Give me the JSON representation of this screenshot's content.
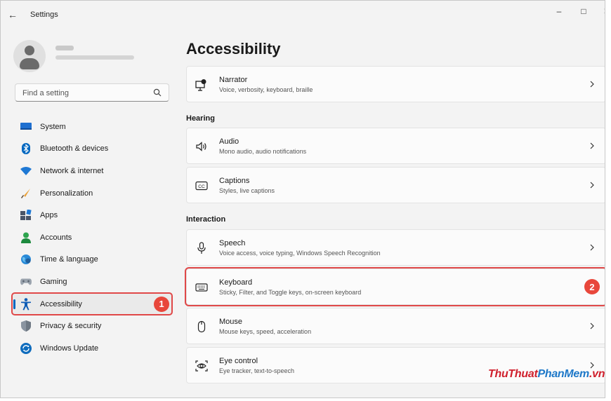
{
  "window": {
    "title": "Settings"
  },
  "sidebar": {
    "search_placeholder": "Find a setting",
    "items": [
      {
        "label": "System",
        "icon": "system-icon"
      },
      {
        "label": "Bluetooth & devices",
        "icon": "bluetooth-icon"
      },
      {
        "label": "Network & internet",
        "icon": "wifi-icon"
      },
      {
        "label": "Personalization",
        "icon": "brush-icon"
      },
      {
        "label": "Apps",
        "icon": "apps-icon"
      },
      {
        "label": "Accounts",
        "icon": "accounts-icon"
      },
      {
        "label": "Time & language",
        "icon": "globe-clock-icon"
      },
      {
        "label": "Gaming",
        "icon": "gamepad-icon"
      },
      {
        "label": "Accessibility",
        "icon": "accessibility-icon",
        "active": true
      },
      {
        "label": "Privacy & security",
        "icon": "shield-icon"
      },
      {
        "label": "Windows Update",
        "icon": "update-icon"
      }
    ],
    "badge": "1"
  },
  "main": {
    "title": "Accessibility",
    "narrator": {
      "title": "Narrator",
      "subtitle": "Voice, verbosity, keyboard, braille"
    },
    "hearing_header": "Hearing",
    "audio": {
      "title": "Audio",
      "subtitle": "Mono audio, audio notifications"
    },
    "captions": {
      "title": "Captions",
      "subtitle": "Styles, live captions"
    },
    "interaction_header": "Interaction",
    "speech": {
      "title": "Speech",
      "subtitle": "Voice access, voice typing, Windows Speech Recognition"
    },
    "keyboard": {
      "title": "Keyboard",
      "subtitle": "Sticky, Filter, and Toggle keys, on-screen keyboard",
      "badge": "2"
    },
    "mouse": {
      "title": "Mouse",
      "subtitle": "Mouse keys, speed, acceleration"
    },
    "eye_control": {
      "title": "Eye control",
      "subtitle": "Eye tracker, text-to-speech"
    }
  },
  "watermark": {
    "part1": "ThuThuat",
    "part2": "PhanMem",
    "part3": ".vn"
  },
  "colors": {
    "accent": "#0067c0",
    "highlight": "#e04848",
    "badge": "#e8473b"
  }
}
